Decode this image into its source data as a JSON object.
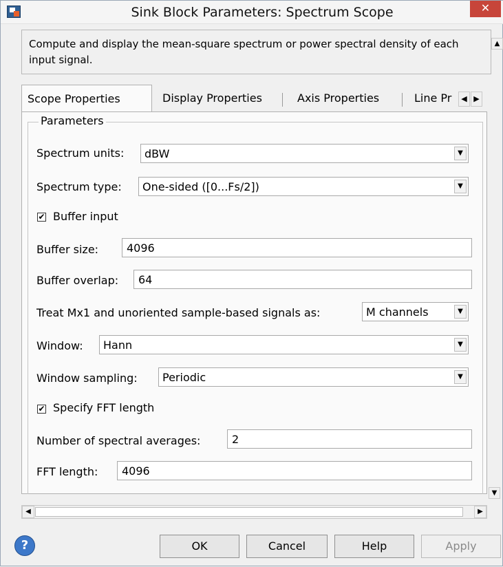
{
  "window": {
    "title": "Sink Block Parameters: Spectrum Scope",
    "close_label": "✕"
  },
  "description": "Compute and display the mean-square spectrum or power spectral density of each input signal.",
  "tabs": [
    {
      "label": "Scope Properties",
      "active": true
    },
    {
      "label": "Display Properties",
      "active": false
    },
    {
      "label": "Axis Properties",
      "active": false
    },
    {
      "label": "Line Pr",
      "active": false
    }
  ],
  "parameters": {
    "group_label": "Parameters",
    "spectrum_units": {
      "label": "Spectrum units:",
      "value": "dBW"
    },
    "spectrum_type": {
      "label": "Spectrum type:",
      "value": "One-sided ([0...Fs/2])"
    },
    "buffer_input": {
      "label": "Buffer input",
      "checked": true
    },
    "buffer_size": {
      "label": "Buffer size:",
      "value": "4096"
    },
    "buffer_overlap": {
      "label": "Buffer overlap:",
      "value": "64"
    },
    "treat_mx1": {
      "label": "Treat Mx1 and unoriented sample-based signals as:",
      "value": "M channels"
    },
    "window": {
      "label": "Window:",
      "value": "Hann"
    },
    "window_sampling": {
      "label": "Window sampling:",
      "value": "Periodic"
    },
    "specify_fft": {
      "label": "Specify FFT length",
      "checked": true
    },
    "spectral_averages": {
      "label": "Number of spectral averages:",
      "value": "2"
    },
    "fft_length": {
      "label": "FFT length:",
      "value": "4096"
    }
  },
  "buttons": {
    "help_icon": "?",
    "ok": "OK",
    "cancel": "Cancel",
    "help": "Help",
    "apply": "Apply"
  },
  "icons": {
    "check_mark": "✔",
    "dropdown_arrow": "▼",
    "scroll_up": "▲",
    "scroll_down": "▼",
    "scroll_left": "◀",
    "scroll_right": "▶"
  }
}
